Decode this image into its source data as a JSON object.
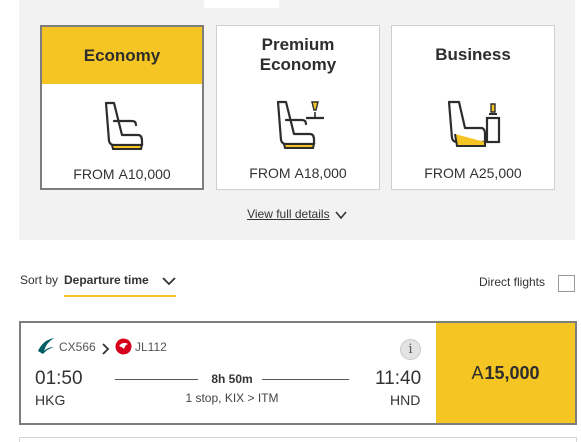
{
  "cabins": [
    {
      "name": "Economy",
      "from_label": "FROM",
      "currency": "A",
      "price": "10,000",
      "selected": true,
      "icon": "economy-seat-icon"
    },
    {
      "name": "Premium Economy",
      "from_label": "FROM",
      "currency": "A",
      "price": "18,000",
      "selected": false,
      "icon": "premium-economy-seat-icon"
    },
    {
      "name": "Business",
      "from_label": "FROM",
      "currency": "A",
      "price": "25,000",
      "selected": false,
      "icon": "business-seat-icon"
    }
  ],
  "view_details_label": "View full details",
  "sort": {
    "label": "Sort by",
    "value": "Departure time"
  },
  "direct_flights": {
    "label": "Direct flights",
    "checked": false
  },
  "flight": {
    "segments": [
      {
        "flight_number": "CX566",
        "airline_icon": "cathay-pacific-logo-icon"
      },
      {
        "flight_number": "JL112",
        "airline_icon": "japan-airlines-logo-icon"
      }
    ],
    "depart_time": "01:50",
    "depart_airport": "HKG",
    "arrive_time": "11:40",
    "arrive_airport": "HND",
    "duration": "8h 50m",
    "stops": "1 stop, KIX > ITM",
    "currency": "A",
    "price": "15,000"
  },
  "colors": {
    "accent": "#f5c523",
    "panel_bg": "#f2f2f2",
    "jal_red": "#d7001c",
    "cathay_green": "#005d63"
  }
}
